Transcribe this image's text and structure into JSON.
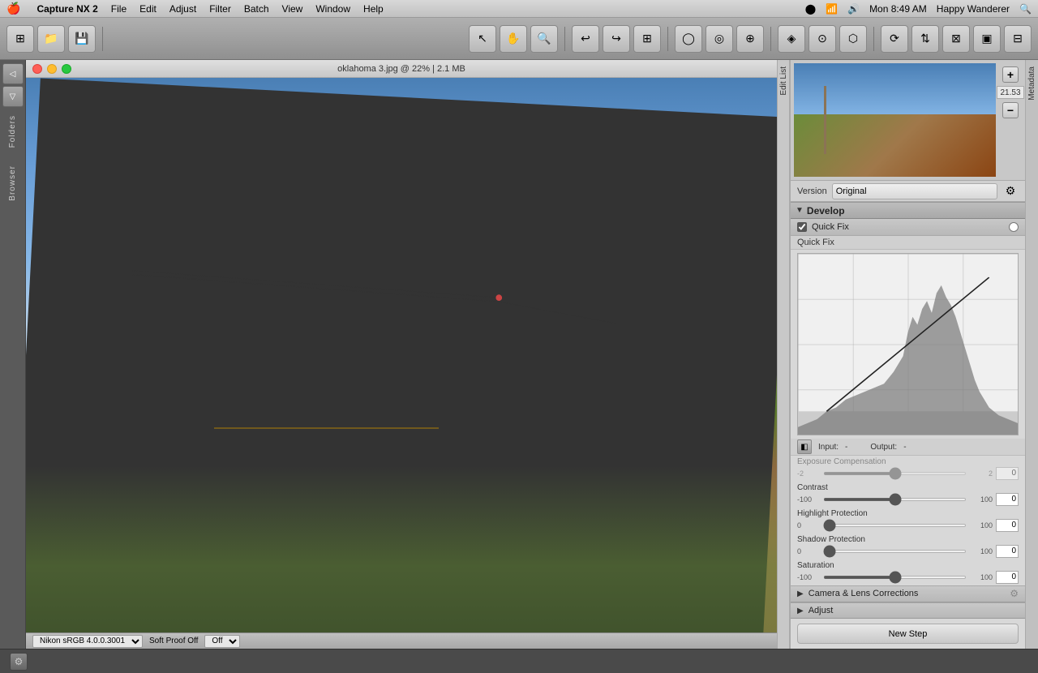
{
  "menubar": {
    "apple": "🍎",
    "appname": "Capture NX 2",
    "items": [
      {
        "label": "File"
      },
      {
        "label": "Edit"
      },
      {
        "label": "Adjust"
      },
      {
        "label": "Filter"
      },
      {
        "label": "Batch"
      },
      {
        "label": "View"
      },
      {
        "label": "Window"
      },
      {
        "label": "Help"
      }
    ],
    "right": {
      "time": "Mon 8:49 AM",
      "user": "Happy Wanderer",
      "search_icon": "🔍"
    }
  },
  "window": {
    "title": "oklahoma 3.jpg @ 22% | 2.1 MB"
  },
  "birds_eye": {
    "zoom_value": "21.53"
  },
  "version": {
    "label": "Version",
    "value": "Original"
  },
  "develop": {
    "title": "Develop"
  },
  "quick_fix": {
    "label": "Quick Fix",
    "label2": "Quick Fix"
  },
  "histogram": {
    "input_label": "Input:",
    "input_value": "-",
    "output_label": "Output:",
    "output_value": "-"
  },
  "sliders": {
    "exposure_compensation": {
      "label": "Exposure Compensation",
      "min": "-2",
      "max": "2",
      "value": "0",
      "thumb_pct": 50
    },
    "contrast": {
      "label": "Contrast",
      "min": "-100",
      "max": "100",
      "value": "0",
      "thumb_pct": 50
    },
    "highlight_protection": {
      "label": "Highlight Protection",
      "min": "0",
      "max": "100",
      "value": "0",
      "thumb_pct": 0
    },
    "shadow_protection": {
      "label": "Shadow Protection",
      "min": "0",
      "max": "100",
      "value": "0",
      "thumb_pct": 0
    },
    "saturation": {
      "label": "Saturation",
      "min": "-100",
      "max": "100",
      "value": "0",
      "thumb_pct": 50
    }
  },
  "camera_lens": {
    "label": "Camera & Lens Corrections"
  },
  "adjust": {
    "label": "Adjust"
  },
  "new_step": {
    "label": "New Step"
  },
  "statusbar": {
    "profile": "Nikon sRGB 4.0.0.3001",
    "softproof": "Soft Proof Off"
  },
  "sidebar": {
    "folders_label": "Folders",
    "browser_label": "Browser",
    "metadata_label": "Metadata"
  },
  "right_sidebar": {
    "edit_list_label": "Edit List"
  }
}
